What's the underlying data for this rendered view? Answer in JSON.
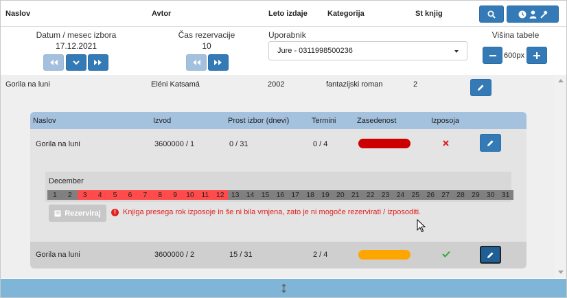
{
  "header": {
    "cols": [
      "Naslov",
      "Avtor",
      "Leto izdaje",
      "Kategorija",
      "St knjig"
    ],
    "search_icon": "search-icon",
    "history_icons": [
      "clock-icon",
      "user-icon",
      "hammer-icon"
    ]
  },
  "controls": {
    "date_label": "Datum / mesec izbora",
    "date_value": "17.12.2021",
    "time_label": "Čas rezervacije",
    "time_value": "10",
    "user_label": "Uporabnik",
    "user_value": "Jure - 0311998500236",
    "height_label": "Višina tabele",
    "height_value": "600px"
  },
  "book": {
    "title": "Gorila na luni",
    "author": "Eléni Katsamá",
    "year": "2002",
    "category": "fantazijski roman",
    "count": "2"
  },
  "subtable": {
    "cols": [
      "Naslov",
      "Izvod",
      "Prost izbor (dnevi)",
      "Termini",
      "Zasedenost",
      "Izposoja"
    ],
    "rows": [
      {
        "title": "Gorila na luni",
        "copy": "3600000 / 1",
        "free": "0 / 31",
        "terms": "0 / 4",
        "occupancy": 1.0,
        "bar_color": "#cc0000",
        "loan": "not-available",
        "loan_icon": "x-icon"
      },
      {
        "title": "Gorila na luni",
        "copy": "3600000 / 2",
        "free": "15 / 31",
        "terms": "2 / 4",
        "occupancy": 1.0,
        "bar_color": "#ffa500",
        "loan": "available",
        "loan_icon": "check-icon"
      }
    ]
  },
  "calendar": {
    "month": "December",
    "days": [
      "1",
      "2",
      "3",
      "4",
      "5",
      "6",
      "7",
      "8",
      "9",
      "10",
      "11",
      "12",
      "13",
      "14",
      "15",
      "16",
      "17",
      "18",
      "19",
      "20",
      "21",
      "22",
      "23",
      "24",
      "25",
      "26",
      "27",
      "28",
      "29",
      "30",
      "31"
    ],
    "busy_days": [
      3,
      4,
      5,
      6,
      7,
      8,
      9,
      10,
      11,
      12
    ]
  },
  "reserve": {
    "label": "Rezerviraj",
    "warning": "Knjiga presega rok izposoje in še ni bila vrnjena, zato je ni mogoče rezervirati / izposoditi."
  },
  "colors": {
    "accent": "#337ab7",
    "subheader": "#a4c2de",
    "footer": "#7fb5d6",
    "busy": "#ff4b4b",
    "free": "#808080",
    "warn": "#e0211f"
  }
}
